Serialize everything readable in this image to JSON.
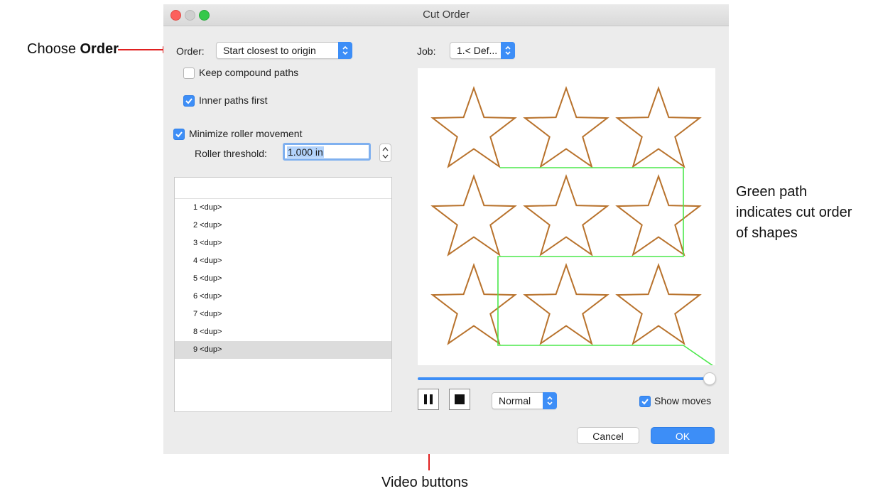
{
  "annotations": {
    "order_prefix": "Choose ",
    "order_bold": "Order",
    "green_path_lines": [
      "Green path",
      "indicates cut order",
      "of shapes"
    ],
    "video_buttons": "Video buttons"
  },
  "window": {
    "title": "Cut Order",
    "order_label": "Order:",
    "order_value": "Start closest to origin",
    "keep_compound_label": "Keep compound paths",
    "keep_compound_checked": false,
    "inner_paths_label": "Inner paths first",
    "inner_paths_checked": true,
    "minimize_roller_label": "Minimize roller movement",
    "minimize_roller_checked": true,
    "roller_threshold_label": "Roller threshold:",
    "roller_threshold_value": "1.000 in",
    "job_label": "Job:",
    "job_value": "1.< Def...",
    "list_items": [
      "1 <dup>",
      "2 <dup>",
      "3 <dup>",
      "4 <dup>",
      "5 <dup>",
      "6 <dup>",
      "7 <dup>",
      "8 <dup>",
      "9 <dup>"
    ],
    "selected_index": 8,
    "speed_value": "Normal",
    "show_moves_label": "Show moves",
    "show_moves_checked": true,
    "cancel_label": "Cancel",
    "ok_label": "OK",
    "progress": 1.0
  },
  "colors": {
    "accent": "#3d8ef7",
    "star_stroke": "#b8722c",
    "star_tip": "#e0443a",
    "move_path": "#4be84b",
    "arrow": "#e02020"
  },
  "icons": {
    "pause": "pause-icon",
    "stop": "stop-icon",
    "popup_arrows": "updown-chevron-icon",
    "checkmark": "checkmark-icon"
  }
}
